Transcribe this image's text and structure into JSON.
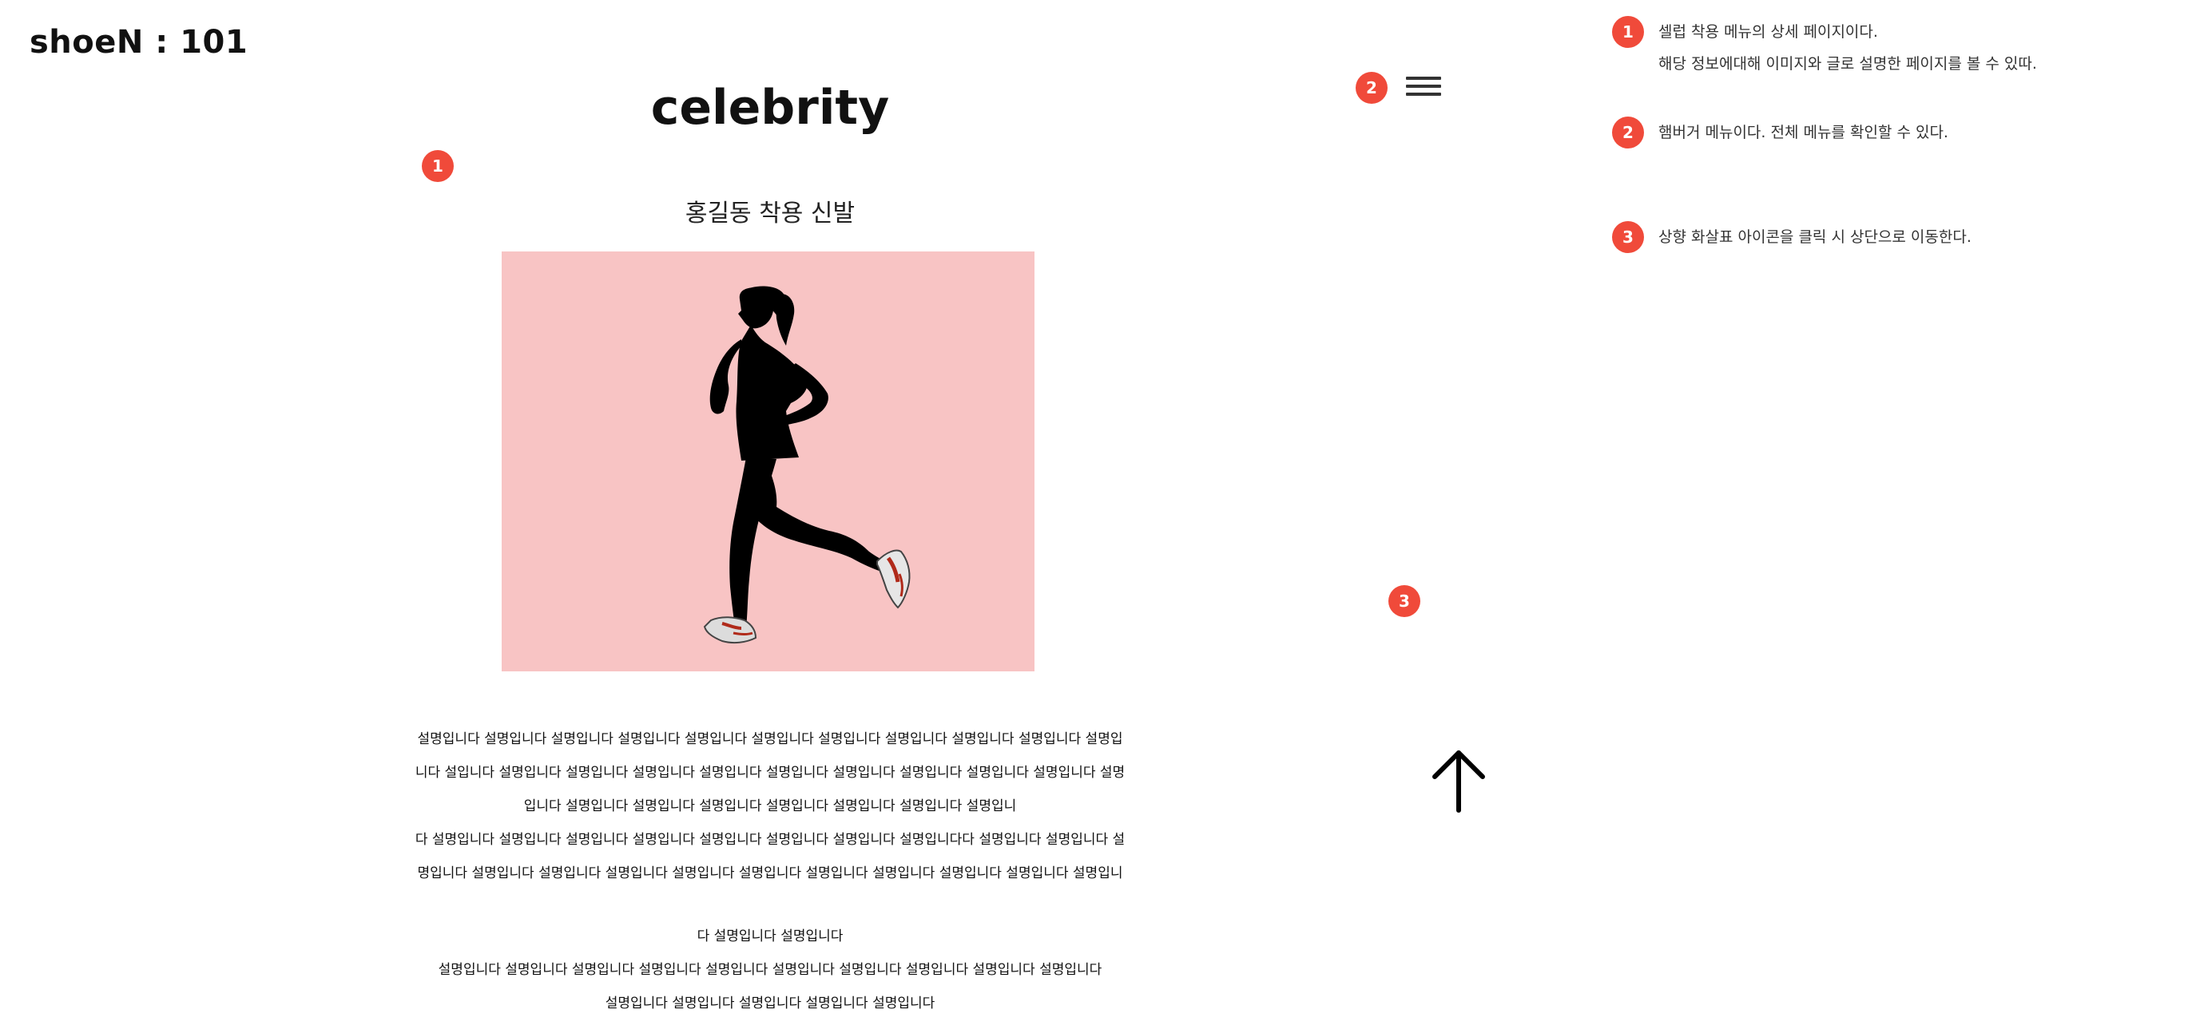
{
  "header": {
    "logo": "shoeN : 101",
    "menu_icon": "hamburger-icon"
  },
  "page": {
    "title": "celebrity",
    "subtitle": "홍길동 착용 신발",
    "hero_image": "runner-silhouette-pink-background",
    "description": {
      "block1": [
        "설명입니다 설명입니다 설명입니다 설명입니다 설명입니다 설명입니다 설명입니다 설명입니다 설명입니다 설명입니다 설명입",
        "니다 설입니다 설명입니다 설명입니다 설명입니다 설명입니다 설명입니다 설명입니다 설명입니다 설명입니다 설명입니다 설명",
        "입니다 설명입니다 설명입니다 설명입니다 설명입니다 설명입니다 설명입니다 설명입니",
        "다  설명입니다 설명입니다 설명입니다 설명입니다 설명입니다 설명입니다 설명입니다 설명입니다다 설명입니다 설명입니다 설",
        "명입니다 설명입니다 설명입니다 설명입니다 설명입니다 설명입니다 설명입니다 설명입니다 설명입니다 설명입니다 설명입니"
      ],
      "block2": [
        "다 설명입니다 설명입니다",
        "설명입니다 설명입니다 설명입니다 설명입니다 설명입니다 설명입니다 설명입니다 설명입니다 설명입니다 설명입니다",
        "설명입니다 설명입니다 설명입니다 설명입니다 설명입니다"
      ]
    },
    "scroll_top_icon": "arrow-up-icon"
  },
  "annotations": {
    "markers": [
      "1",
      "2",
      "3"
    ],
    "notes": [
      {
        "num": "1",
        "lines": [
          "셀럽 착용 메뉴의 상세 페이지이다.",
          "해당 정보에대해 이미지와 글로 설명한 페이지를 볼 수 있따."
        ]
      },
      {
        "num": "2",
        "lines": [
          "햄버거 메뉴이다. 전체 메뉴를 확인할 수 있다."
        ]
      },
      {
        "num": "3",
        "lines": [
          "상향 화살표 아이콘을 클릭 시 상단으로 이동한다."
        ]
      }
    ]
  },
  "colors": {
    "badge": "#f04a3a",
    "hero_bg": "#f8c4c4",
    "text": "#111111"
  }
}
